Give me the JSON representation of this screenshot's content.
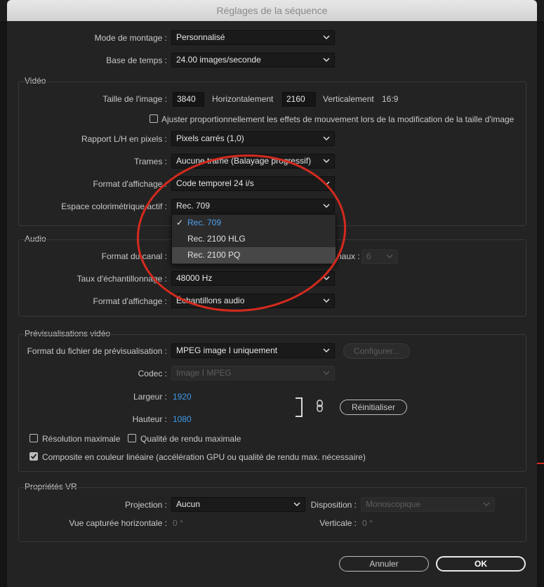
{
  "window": {
    "title": "Réglages de la séquence"
  },
  "top": {
    "mode_label": "Mode de montage :",
    "mode_value": "Personnalisé",
    "timebase_label": "Base de temps :",
    "timebase_value": "24.00  images/seconde"
  },
  "video": {
    "group_title": "Vidéo",
    "frame_size_label": "Taille de l'image :",
    "width_value": "3840",
    "horizontal_label": "Horizontalement",
    "height_value": "2160",
    "vertical_label": "Verticalement",
    "aspect": "16:9",
    "scale_checkbox_label": "Ajuster proportionnellement les effets de mouvement lors de la modification de la taille d'image",
    "pixel_aspect_label": "Rapport L/H en pixels :",
    "pixel_aspect_value": "Pixels carrés (1,0)",
    "fields_label": "Trames :",
    "fields_value": "Aucune trame (Balayage progressif)",
    "display_format_label": "Format d'affichage :",
    "display_format_value": "Code temporel 24 i/s",
    "color_space_label": "Espace colorimétrique actif :",
    "color_space_value": "Rec. 709",
    "color_space_options": [
      "Rec. 709",
      "Rec. 2100 HLG",
      "Rec. 2100 PQ"
    ]
  },
  "audio": {
    "group_title": "Audio",
    "channel_format_label": "Format du canal :",
    "channels_label": "naux :",
    "channels_value": "6",
    "sample_rate_label": "Taux d'échantillonnage :",
    "sample_rate_value": "48000 Hz",
    "display_format_label": "Format d'affichage :",
    "display_format_value": "Échantillons audio"
  },
  "preview": {
    "group_title": "Prévisualisations vidéo",
    "file_format_label": "Format du fichier de prévisualisation :",
    "file_format_value": "MPEG image I uniquement",
    "configure_label": "Configurer...",
    "codec_label": "Codec :",
    "codec_value": "Image I MPEG",
    "width_label": "Largeur :",
    "width_value": "1920",
    "height_label": "Hauteur :",
    "height_value": "1080",
    "reset_label": "Réinitialiser",
    "max_res_label": "Résolution maximale",
    "max_quality_label": "Qualité de rendu maximale",
    "linear_label": "Composite en couleur linéaire (accélération GPU ou qualité de rendu max. nécessaire)"
  },
  "vr": {
    "group_title": "Propriétés VR",
    "projection_label": "Projection :",
    "projection_value": "Aucun",
    "layout_label": "Disposition :",
    "layout_value": "Monoscopique",
    "hcapture_label": "Vue capturée horizontale :",
    "hcapture_value": "0 °",
    "vertical_label": "Verticale :",
    "vertical_value": "0 °"
  },
  "footer": {
    "cancel_label": "Annuler",
    "ok_label": "OK"
  },
  "colors": {
    "annotation_circle": "#d42a1e",
    "link_blue": "#3d9ae8",
    "dialog_bg": "#232323"
  }
}
